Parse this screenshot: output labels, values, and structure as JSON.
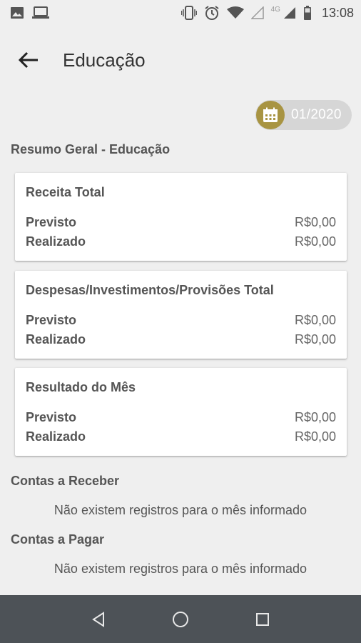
{
  "status_bar": {
    "time": "13:08",
    "network": "4G",
    "icons": [
      "image-icon",
      "laptop-icon",
      "vibrate-icon",
      "alarm-icon",
      "wifi-icon",
      "signal-icon",
      "battery-icon"
    ]
  },
  "app_bar": {
    "title": "Educação",
    "back_icon": "arrow-back-icon"
  },
  "date_chip": {
    "icon": "calendar-icon",
    "value": "01/2020",
    "color": "#a89442"
  },
  "summary": {
    "title": "Resumo Geral - Educação",
    "cards": [
      {
        "title": "Receita Total",
        "rows": [
          {
            "label": "Previsto",
            "value": "R$0,00"
          },
          {
            "label": "Realizado",
            "value": "R$0,00"
          }
        ]
      },
      {
        "title": "Despesas/Investimentos/Provisões Total",
        "rows": [
          {
            "label": "Previsto",
            "value": "R$0,00"
          },
          {
            "label": "Realizado",
            "value": "R$0,00"
          }
        ]
      },
      {
        "title": "Resultado do Mês",
        "rows": [
          {
            "label": "Previsto",
            "value": "R$0,00"
          },
          {
            "label": "Realizado",
            "value": "R$0,00"
          }
        ]
      }
    ]
  },
  "receivables": {
    "title": "Contas a Receber",
    "empty_message": "Não existem registros para o mês informado"
  },
  "payables": {
    "title": "Contas a Pagar",
    "empty_message": "Não existem registros para o mês informado"
  },
  "nav_bar": {
    "icons": [
      "nav-back-icon",
      "nav-home-icon",
      "nav-recents-icon"
    ]
  }
}
